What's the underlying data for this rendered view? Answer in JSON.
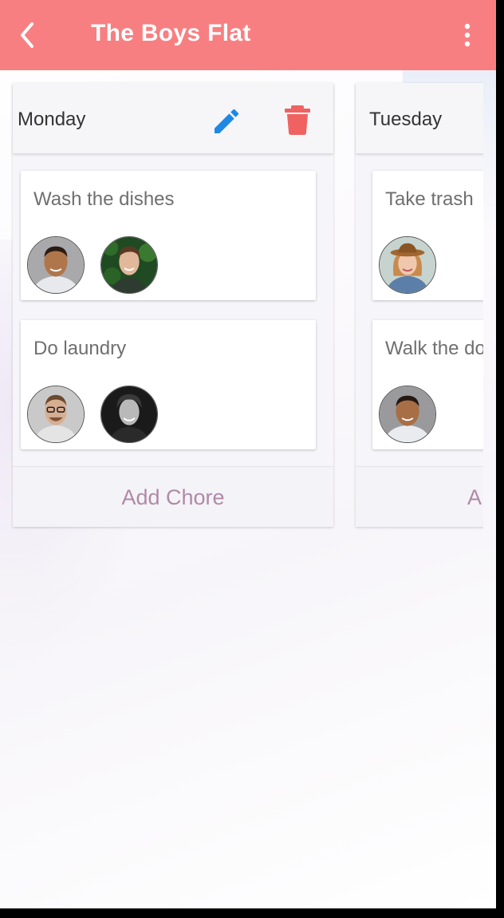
{
  "app": {
    "title": "The Boys Flat",
    "accent_color": "#f87f81",
    "back_icon": "chevron-left-icon",
    "menu_icon": "more-vert-icon"
  },
  "columns": [
    {
      "day": "Monday",
      "edit_icon": "pencil-icon",
      "delete_icon": "trash-icon",
      "chores": [
        {
          "title": "Wash the dishes",
          "assignees": [
            "person-avatar",
            "person-avatar"
          ]
        },
        {
          "title": "Do laundry",
          "assignees": [
            "person-avatar",
            "person-avatar"
          ]
        }
      ],
      "add_label": "Add Chore"
    },
    {
      "day": "Tuesday",
      "chores": [
        {
          "title": "Take trash",
          "assignees": [
            "person-avatar"
          ]
        },
        {
          "title": "Walk the do",
          "assignees": [
            "person-avatar"
          ]
        }
      ],
      "add_label": "A"
    }
  ],
  "colors": {
    "edit_icon": "#1e88e5",
    "delete_icon": "#f06262",
    "add_text": "#b08aa6"
  }
}
